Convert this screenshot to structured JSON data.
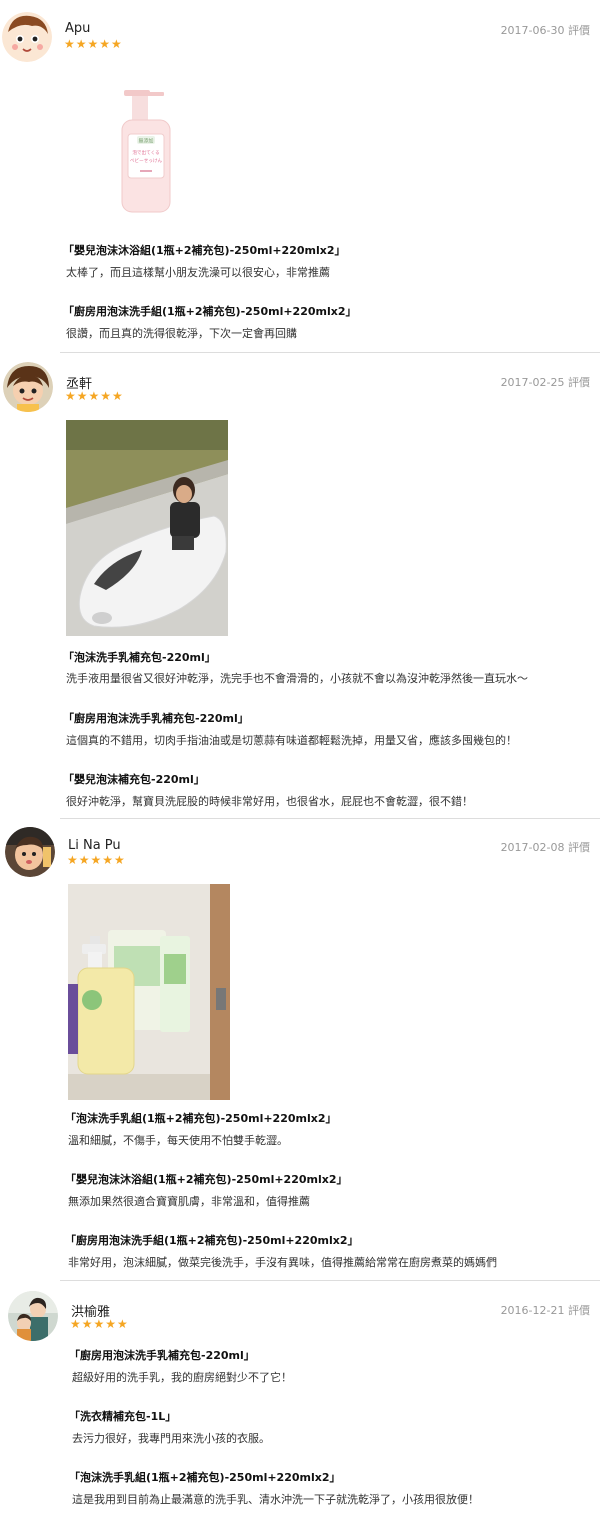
{
  "reviews": [
    {
      "user": "Apu",
      "date": "2017-06-30 評價",
      "stars": "★★★★★",
      "items": [
        {
          "title": "「嬰兒泡沫沐浴組(1瓶+2補充包)-250ml+220mlx2」",
          "text": "太棒了，而且這樣幫小朋友洗澡可以很安心，非常推薦"
        },
        {
          "title": "「廚房用泡沫洗手組(1瓶+2補充包)-250ml+220mlx2」",
          "text": "很讚，而且真的洗得很乾淨，下次一定會再回購"
        }
      ]
    },
    {
      "user": "丞軒",
      "date": "2017-02-25 評價",
      "stars": "★★★★★",
      "items": [
        {
          "title": "「泡沫洗手乳補充包-220ml」",
          "text": "洗手液用量很省又很好沖乾淨，洗完手也不會滑滑的，小孩就不會以為沒沖乾淨然後一直玩水～"
        },
        {
          "title": "「廚房用泡沫洗手乳補充包-220ml」",
          "text": "這個真的不錯用，切肉手指油油或是切蔥蒜有味道都輕鬆洗掉，用量又省，應該多囤幾包的！"
        },
        {
          "title": "「嬰兒泡沫補充包-220ml」",
          "text": "很好沖乾淨，幫寶貝洗屁股的時候非常好用，也很省水，屁屁也不會乾澀，很不錯！"
        }
      ]
    },
    {
      "user": "Li Na Pu",
      "date": "2017-02-08 評價",
      "stars": "★★★★★",
      "items": [
        {
          "title": "「泡沫洗手乳組(1瓶+2補充包)-250ml+220mlx2」",
          "text": "溫和細膩，不傷手，每天使用不怕雙手乾澀。"
        },
        {
          "title": "「嬰兒泡沫沐浴組(1瓶+2補充包)-250ml+220mlx2」",
          "text": "無添加果然很適合寶寶肌膚，非常溫和，值得推薦"
        },
        {
          "title": "「廚房用泡沫洗手組(1瓶+2補充包)-250ml+220mlx2」",
          "text": "非常好用，泡沫細膩，做菜完後洗手，手沒有異味，值得推薦給常常在廚房煮菜的媽媽們"
        }
      ]
    },
    {
      "user": "洪榆雅",
      "date": "2016-12-21 評價",
      "stars": "★★★★★",
      "items": [
        {
          "title": "「廚房用泡沫洗手乳補充包-220ml」",
          "text": "超級好用的洗手乳，我的廚房絕對少不了它！"
        },
        {
          "title": "「洗衣精補充包-1L」",
          "text": "去污力很好，我專門用來洗小孩的衣服。"
        },
        {
          "title": "「泡沫洗手乳組(1瓶+2補充包)-250ml+220mlx2」",
          "text": "這是我用到目前為止最滿意的洗手乳、清水沖洗一下子就洗乾淨了，小孩用很放便！"
        }
      ]
    }
  ],
  "product_label": {
    "brand": "無添加",
    "line1": "泡で出てくる",
    "line2": "ベビーせっけん"
  },
  "colors": {
    "star": "#f5a623",
    "divider": "#dddddd"
  }
}
